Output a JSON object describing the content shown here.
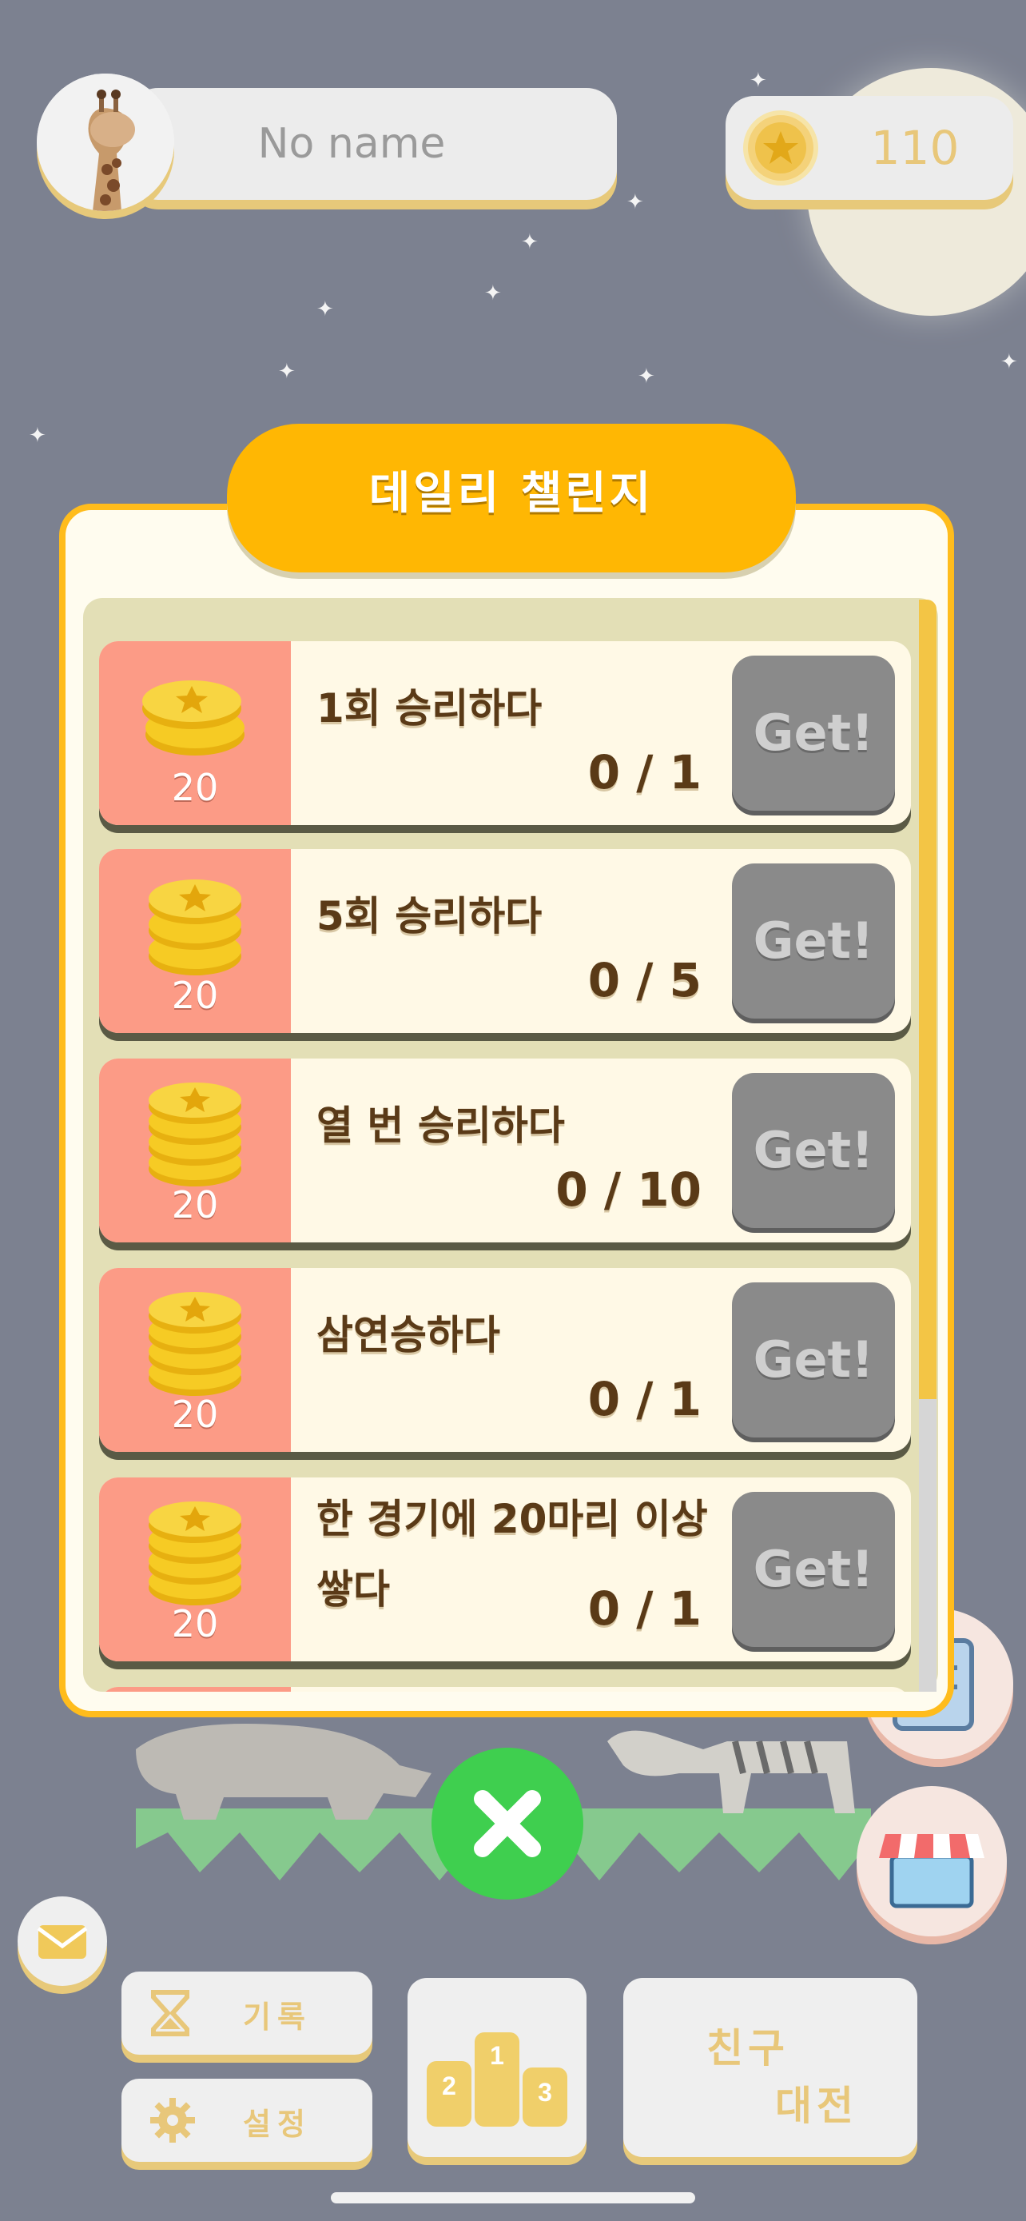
{
  "profile": {
    "name": "No name",
    "avatar_icon": "giraffe-icon"
  },
  "coins": {
    "count": "110",
    "icon": "star-coin-icon"
  },
  "challenge_panel": {
    "title": "데일리 챌린지",
    "items": [
      {
        "reward": "20",
        "label": "1회 승리하다",
        "progress": "0 / 1",
        "button": "Get!"
      },
      {
        "reward": "20",
        "label": "5회 승리하다",
        "progress": "0 / 5",
        "button": "Get!"
      },
      {
        "reward": "20",
        "label": "열 번 승리하다",
        "progress": "0 / 10",
        "button": "Get!"
      },
      {
        "reward": "20",
        "label": "삼연승하다",
        "progress": "0 / 1",
        "button": "Get!"
      },
      {
        "reward": "20",
        "label": "한 경기에 20마리 이상 쌓다",
        "progress": "0 / 1",
        "button": "Get!"
      }
    ]
  },
  "bottom_menu": {
    "history_label": "기록",
    "settings_label": "설정",
    "friend_match_line1": "친구",
    "friend_match_line2": "대전"
  },
  "colors": {
    "background": "#7c8190",
    "panel_accent": "#ffb703",
    "reward_bg": "#fc9b86",
    "button_disabled": "#8a8a8a",
    "close_green": "#3fcf4f",
    "gold_text": "#e8c77a"
  }
}
